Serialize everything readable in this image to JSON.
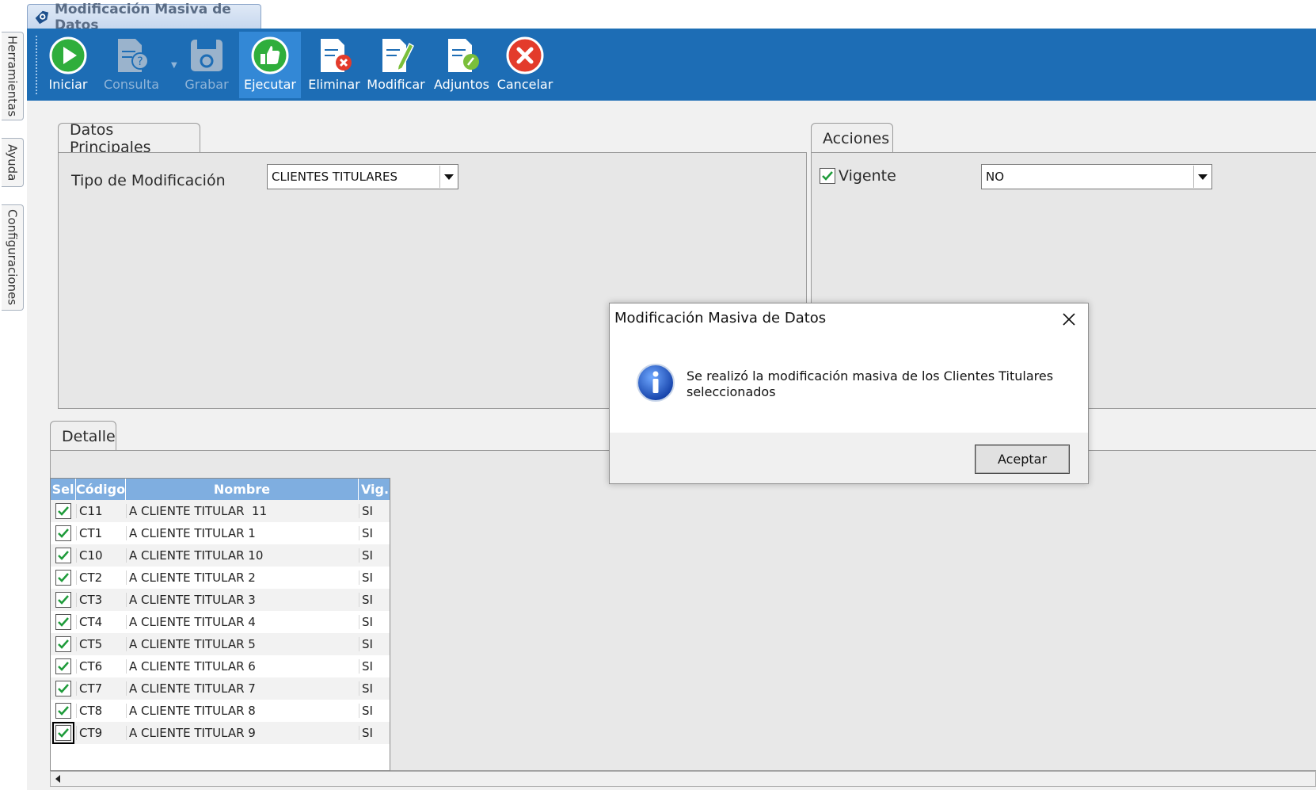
{
  "side_tabs": [
    "Herramientas",
    "Ayuda",
    "Configuraciones"
  ],
  "window": {
    "title": "Modificación Masiva de Datos"
  },
  "toolbar": {
    "buttons": [
      {
        "label": "Iniciar",
        "icon": "play-circle-icon",
        "state": "enabled"
      },
      {
        "label": "Consulta",
        "icon": "document-query-icon",
        "state": "disabled"
      },
      {
        "label": "Grabar",
        "icon": "floppy-disk-icon",
        "state": "disabled"
      },
      {
        "label": "Ejecutar",
        "icon": "thumbs-up-icon",
        "state": "active"
      },
      {
        "label": "Eliminar",
        "icon": "document-delete-icon",
        "state": "enabled"
      },
      {
        "label": "Modificar",
        "icon": "document-edit-icon",
        "state": "enabled"
      },
      {
        "label": "Adjuntos",
        "icon": "attachment-icon",
        "state": "enabled"
      },
      {
        "label": "Cancelar",
        "icon": "cancel-icon",
        "state": "enabled"
      }
    ]
  },
  "datos_principales": {
    "tab_label": "Datos Principales",
    "tipo_label": "Tipo de Modificación",
    "tipo_value": "CLIENTES TITULARES"
  },
  "acciones": {
    "tab_label": "Acciones",
    "vigente_label": "Vigente",
    "vigente_checked": true,
    "vigente_value": "NO"
  },
  "detalle": {
    "tab_label": "Detalle",
    "columns": [
      "Sel",
      "Código",
      "Nombre",
      "Vig."
    ],
    "rows": [
      {
        "sel": true,
        "codigo": "C11",
        "nombre": "A CLIENTE TITULAR  11",
        "vig": "SI"
      },
      {
        "sel": true,
        "codigo": "CT1",
        "nombre": "A CLIENTE TITULAR 1",
        "vig": "SI"
      },
      {
        "sel": true,
        "codigo": "C10",
        "nombre": "A CLIENTE TITULAR 10",
        "vig": "SI"
      },
      {
        "sel": true,
        "codigo": "CT2",
        "nombre": "A CLIENTE TITULAR 2",
        "vig": "SI"
      },
      {
        "sel": true,
        "codigo": "CT3",
        "nombre": "A CLIENTE TITULAR 3",
        "vig": "SI"
      },
      {
        "sel": true,
        "codigo": "CT4",
        "nombre": "A CLIENTE TITULAR 4",
        "vig": "SI"
      },
      {
        "sel": true,
        "codigo": "CT5",
        "nombre": "A CLIENTE TITULAR 5",
        "vig": "SI"
      },
      {
        "sel": true,
        "codigo": "CT6",
        "nombre": "A CLIENTE TITULAR 6",
        "vig": "SI"
      },
      {
        "sel": true,
        "codigo": "CT7",
        "nombre": "A CLIENTE TITULAR 7",
        "vig": "SI"
      },
      {
        "sel": true,
        "codigo": "CT8",
        "nombre": "A CLIENTE TITULAR 8",
        "vig": "SI"
      },
      {
        "sel": true,
        "codigo": "CT9",
        "nombre": "A CLIENTE TITULAR 9",
        "vig": "SI"
      }
    ]
  },
  "dialog": {
    "title": "Modificación Masiva de Datos",
    "message": "Se realizó la modificación masiva de los Clientes Titulares seleccionados",
    "icon": "info-icon",
    "ok_label": "Aceptar"
  },
  "colors": {
    "toolbar": "#1d6db5",
    "grid_header": "#7faee0",
    "check": "#1e9b3a"
  }
}
